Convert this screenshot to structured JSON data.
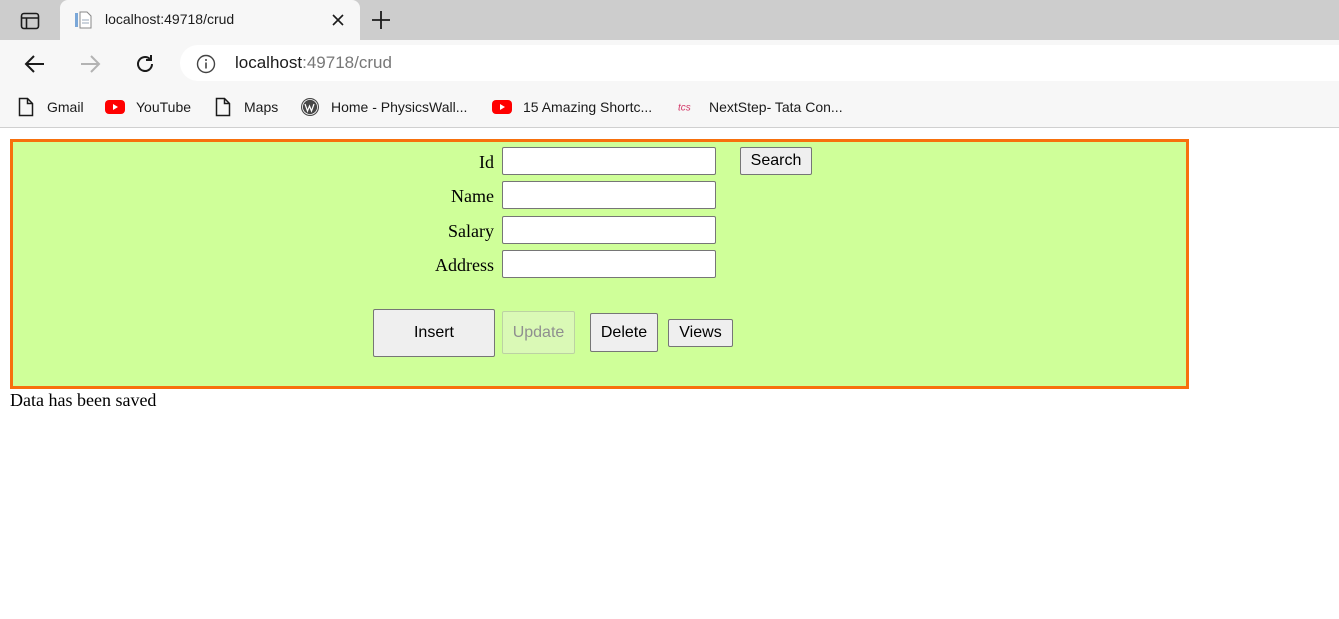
{
  "browser": {
    "tab": {
      "title": "localhost:49718/crud"
    },
    "address": {
      "host": "localhost",
      "path": ":49718/crud"
    },
    "bookmarks": [
      {
        "label": "Gmail",
        "icon": "page-icon"
      },
      {
        "label": "YouTube",
        "icon": "youtube-icon"
      },
      {
        "label": "Maps",
        "icon": "page-icon"
      },
      {
        "label": "Home - PhysicsWall...",
        "icon": "wordpress-icon"
      },
      {
        "label": "15 Amazing Shortc...",
        "icon": "youtube-icon"
      },
      {
        "label": "NextStep- Tata Con...",
        "icon": "tcs-icon"
      }
    ],
    "tcs_logo_text": "tcs"
  },
  "form": {
    "fields": [
      {
        "label": "Id",
        "value": ""
      },
      {
        "label": "Name",
        "value": ""
      },
      {
        "label": "Salary",
        "value": ""
      },
      {
        "label": "Address",
        "value": ""
      }
    ],
    "search_label": "Search",
    "insert_label": "Insert",
    "update_label": "Update",
    "delete_label": "Delete",
    "views_label": "Views"
  },
  "status_message": "Data has been saved",
  "colors": {
    "panel_bg": "#cfff99",
    "panel_border": "#f7700d",
    "youtube_red": "#ff0000"
  }
}
